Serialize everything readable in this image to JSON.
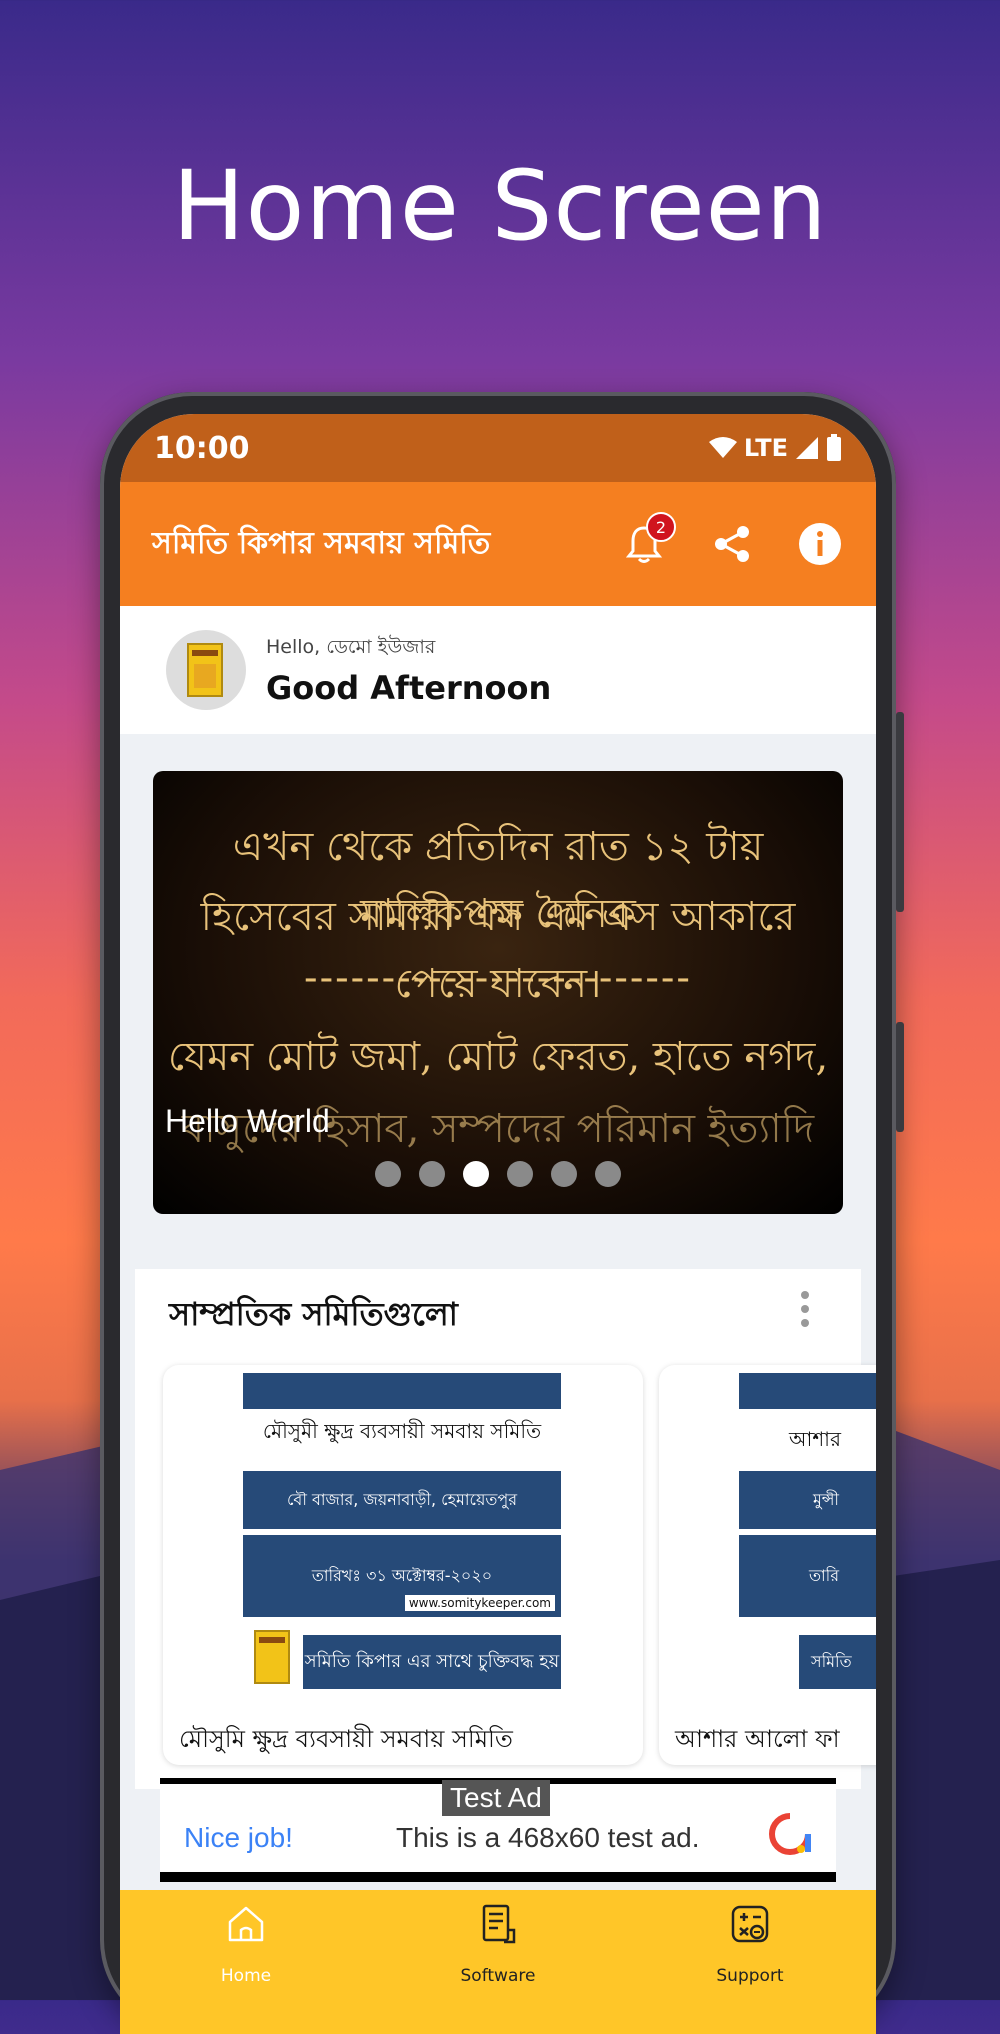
{
  "promo": {
    "title": "Home Screen"
  },
  "status_bar": {
    "time": "10:00",
    "network": "LTE"
  },
  "app_bar": {
    "title": "সমিতি কিপার সমবায় সমিতি",
    "notification_count": "2",
    "icons": [
      "bell-icon",
      "share-icon",
      "info-icon"
    ]
  },
  "greeting": {
    "hello": "Hello, ডেমো ইউজার",
    "message": "Good Afternoon"
  },
  "banner": {
    "lines": [
      "এখন থেকে প্রতিদিন রাত ১২ টায় মালিকপক্ষ দৈনিক",
      "হিসেবের সামারী এস এম এস আকারে পেয়ে যাবেন।",
      "-------------------------",
      "যেমন মোট জমা, মোট ফেরত, হাতে নগদ,",
      "বাসুদের হিসাব, সম্পদের পরিমান ইত্যাদি"
    ],
    "caption": "Hello World",
    "dot_count": 6,
    "active_dot": 3
  },
  "recent": {
    "heading": "সাম্প্রতিক সমিতিগুলো",
    "cards": [
      {
        "poster_title": "মৌসুমী ক্ষুদ্র ব্যবসায়ী সমবায় সমিতি",
        "address": "বৌ বাজার, জয়নাবাড়ী, হেমায়েতপুর",
        "date": "তারিখঃ ৩১ অক্টোম্বর-২০২০",
        "website": "www.somitykeeper.com",
        "tagline": "সমিতি কিপার এর সাথে চুক্তিবদ্ধ হয়",
        "name": "মৌসুমি ক্ষুদ্র ব্যবসায়ী সমবায় সমিতি"
      },
      {
        "poster_title": "আশার",
        "address": "মুন্সী",
        "date": "তারি",
        "tagline": "সমিতি",
        "name": "আশার আলো ফা"
      }
    ]
  },
  "ad": {
    "label": "Test Ad",
    "headline": "Nice job!",
    "text": "This is a 468x60 test ad."
  },
  "bottom_nav": {
    "items": [
      {
        "label": "Home",
        "icon": "home-icon",
        "active": true
      },
      {
        "label": "Software",
        "icon": "document-icon",
        "active": false
      },
      {
        "label": "Support",
        "icon": "calculator-icon",
        "active": false
      }
    ]
  },
  "colors": {
    "app_bar": "#f57f20",
    "status_bar": "#c0601a",
    "bottom_nav": "#ffc628",
    "badge": "#d0141e"
  }
}
